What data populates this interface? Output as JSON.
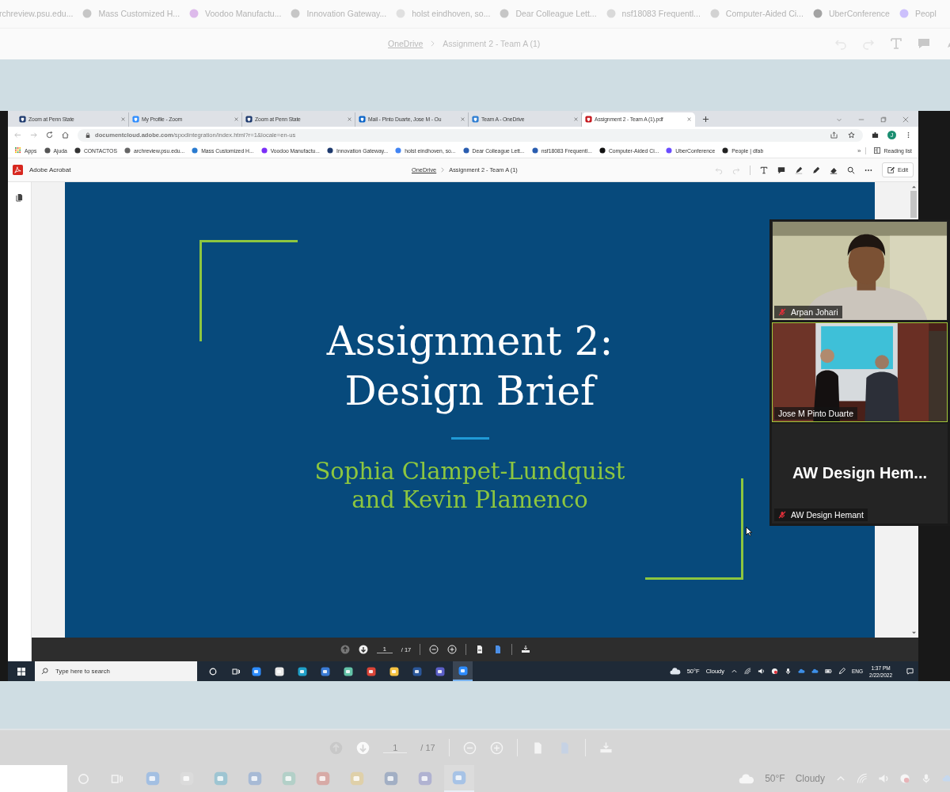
{
  "ghost_top": {
    "bookmarks": [
      "rchreview.psu.edu...",
      "Mass Customized H...",
      "Voodoo Manufactu...",
      "Innovation Gateway...",
      "holst eindhoven, so...",
      "Dear Colleague Lett...",
      "nsf18083 Frequentl...",
      "Computer-Aided Ci...",
      "UberConference",
      "Peopl"
    ],
    "breadcrumb_link": "OneDrive",
    "breadcrumb_current": "Assignment 2 - Team A (1)"
  },
  "browser": {
    "tabs": [
      {
        "title": "Zoom at Penn State",
        "selected": false
      },
      {
        "title": "My Profile - Zoom",
        "selected": false
      },
      {
        "title": "Zoom at Penn State",
        "selected": false
      },
      {
        "title": "Mail - Pinto Duarte, Jose M - Ou",
        "selected": false
      },
      {
        "title": "Team A - OneDrive",
        "selected": false
      },
      {
        "title": "Assignment 2 - Team A (1).pdf",
        "selected": true
      }
    ],
    "url": "**documentcloud.adobe.com**/spodintegration/index.html?r=1&locale=en-us",
    "profile_initial": "J",
    "bookmarks": [
      "Apps",
      "Ajuda",
      "CONTACTOS",
      "archreview.psu.edu...",
      "Mass Customized H...",
      "Voodoo Manufactu...",
      "Innovation Gateway...",
      "holst eindhoven, so...",
      "Dear Colleague Lett...",
      "nsf18083 Frequentl...",
      "Computer-Aided Ci...",
      "UberConference",
      "People | dfab"
    ],
    "bookmarks_more": "»",
    "reading_list": "Reading list"
  },
  "acrobat": {
    "app_name": "Adobe Acrobat",
    "breadcrumb_link": "OneDrive",
    "breadcrumb_current": "Assignment 2 - Team A (1)",
    "edit": "Edit"
  },
  "slide": {
    "title": [
      "Assignment 2:",
      "Design Brief"
    ],
    "authors": [
      "Sophia Clampet-Lundquist",
      "and Kevin Plamenco"
    ]
  },
  "pdf_toolbar": {
    "page": "1",
    "total": "/ 17"
  },
  "taskbar": {
    "search_placeholder": "Type here to search",
    "apps": [
      {
        "active": false
      },
      {
        "active": false
      },
      {
        "active": false
      },
      {
        "active": false
      },
      {
        "active": false
      },
      {
        "active": false
      },
      {
        "active": false
      },
      {
        "active": false
      },
      {
        "active": false
      },
      {
        "active": true
      }
    ],
    "temperature": "50°F",
    "weather": "Cloudy",
    "language": "ENG",
    "time": "1:37 PM",
    "date": "2/22/2022"
  },
  "zoom": {
    "participants": [
      {
        "name": "Arpan Johari",
        "kind": "video",
        "muted": true,
        "active_speaker": false
      },
      {
        "name": "Jose M Pinto Duarte",
        "kind": "video",
        "muted": false,
        "active_speaker": true
      },
      {
        "name": "AW Design Hemant",
        "kind": "name_only",
        "display_name": "AW Design Hem...",
        "muted": true,
        "active_speaker": false
      }
    ]
  },
  "ghost_bottom": {
    "page": "1",
    "total": "/ 17",
    "apps": [
      {
        "active": false
      },
      {
        "active": false
      },
      {
        "active": false
      },
      {
        "active": false
      },
      {
        "active": false
      },
      {
        "active": false
      },
      {
        "active": false
      },
      {
        "active": false
      },
      {
        "active": false
      },
      {
        "active": true
      }
    ],
    "temperature": "50°F",
    "weather": "Cloudy"
  }
}
